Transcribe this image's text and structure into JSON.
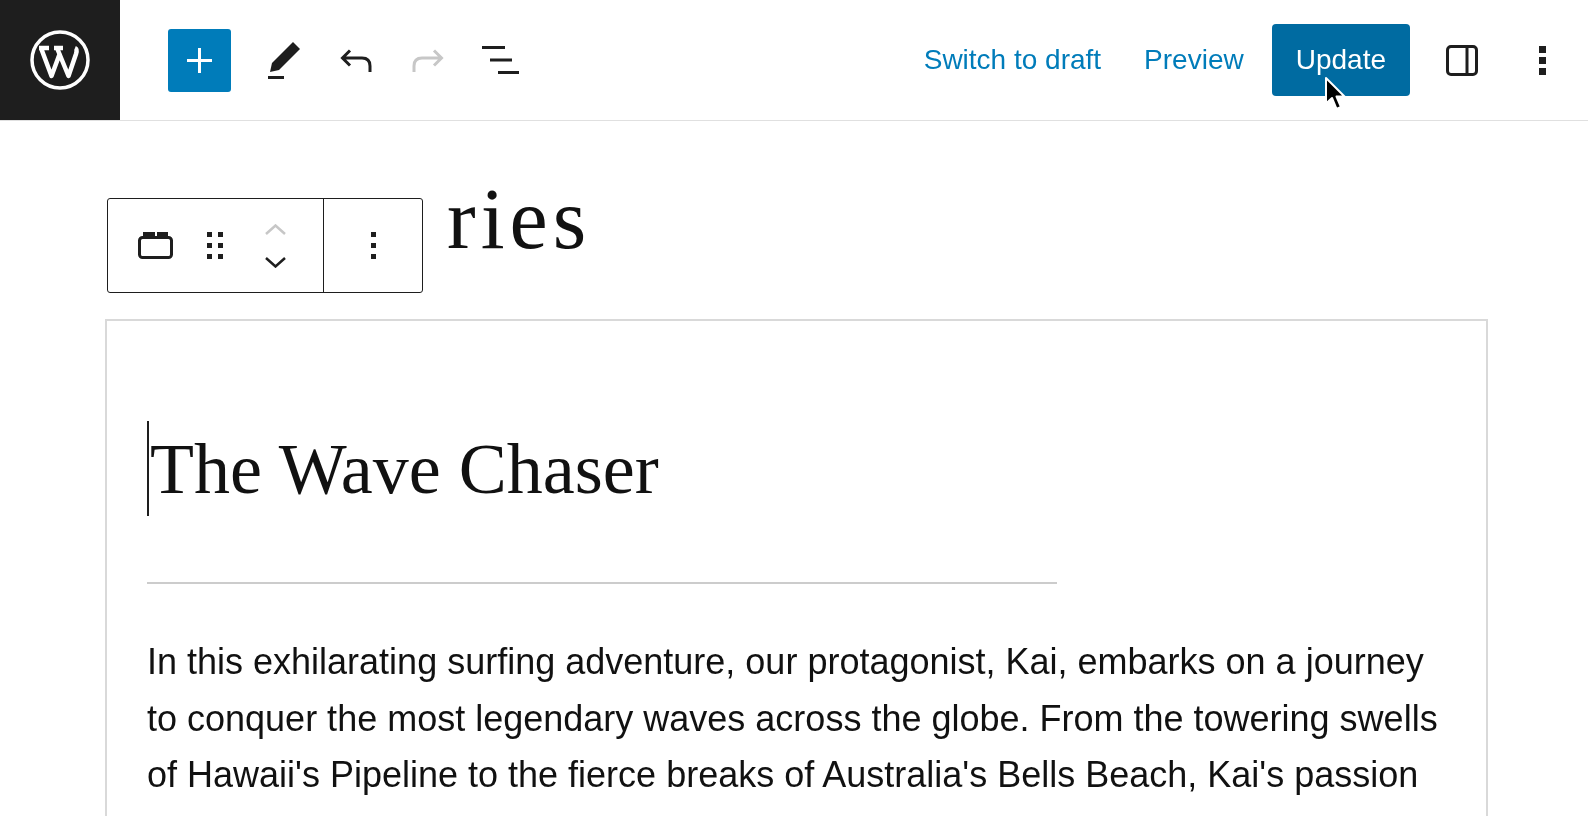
{
  "top_bar": {
    "tools": [
      {
        "kind": "inserter",
        "disabled": false
      },
      {
        "kind": "tools",
        "disabled": false
      },
      {
        "kind": "undo",
        "disabled": false
      },
      {
        "kind": "redo",
        "disabled": true
      },
      {
        "kind": "list_view",
        "disabled": false
      }
    ],
    "actions": [
      {
        "kind": "link",
        "label": "Switch to draft"
      },
      {
        "kind": "link",
        "label": "Preview"
      },
      {
        "kind": "primary",
        "label": "Update"
      },
      {
        "kind": "settings"
      },
      {
        "kind": "more"
      }
    ]
  },
  "editor": {
    "post_title": "ries",
    "block_toolbar": {
      "groups": [
        {
          "buttons": [
            {
              "kind": "block_type",
              "disabled": false
            },
            {
              "kind": "drag",
              "disabled": false
            },
            {
              "kind": "move_up",
              "disabled": true
            },
            {
              "kind": "move_down",
              "disabled": false
            }
          ]
        },
        {
          "buttons": [
            {
              "kind": "options",
              "disabled": false
            }
          ]
        }
      ]
    },
    "group_block": {
      "blocks": [
        {
          "kind": "heading",
          "text": "The Wave Chaser",
          "focused": true
        },
        {
          "kind": "separator"
        },
        {
          "kind": "paragraph",
          "text": "In this exhilarating surfing adventure, our protagonist, Kai, embarks on a journey to conquer the most legendary waves across the globe. From the towering swells of Hawaii's Pipeline to the fierce breaks of Australia's Bells Beach, Kai's passion"
        }
      ]
    }
  }
}
